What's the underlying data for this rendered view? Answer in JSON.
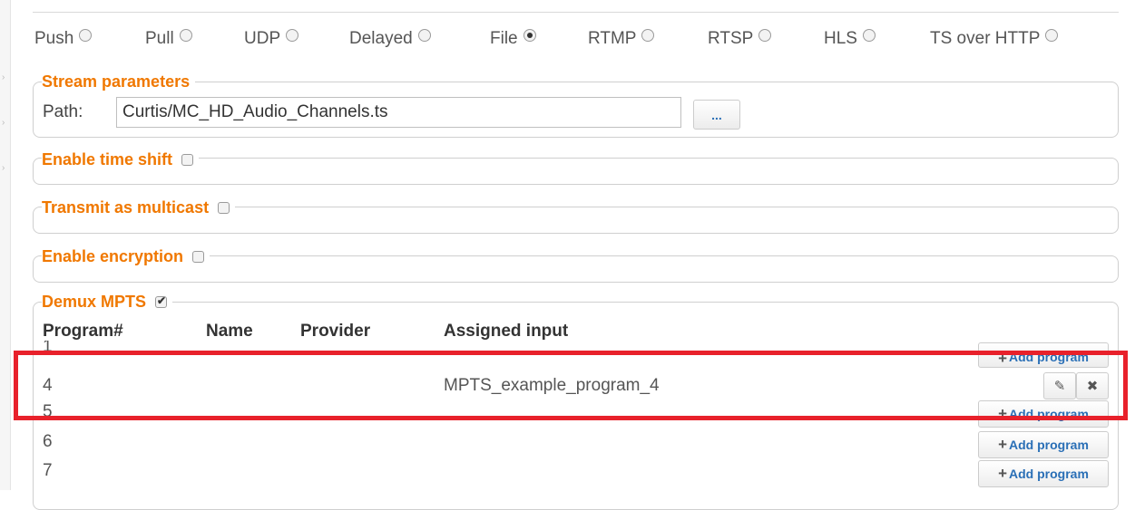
{
  "modes": [
    {
      "label": "Push",
      "checked": false
    },
    {
      "label": "Pull",
      "checked": false
    },
    {
      "label": "UDP",
      "checked": false
    },
    {
      "label": "Delayed",
      "checked": false
    },
    {
      "label": "File",
      "checked": true
    },
    {
      "label": "RTMP",
      "checked": false
    },
    {
      "label": "RTSP",
      "checked": false
    },
    {
      "label": "HLS",
      "checked": false
    },
    {
      "label": "TS over HTTP",
      "checked": false
    }
  ],
  "stream_parameters": {
    "legend": "Stream parameters",
    "path_label": "Path:",
    "path_value": "Curtis/MC_HD_Audio_Channels.ts",
    "browse_label": "..."
  },
  "time_shift": {
    "legend": "Enable time shift",
    "checked": false
  },
  "multicast": {
    "legend": "Transmit as multicast",
    "checked": false
  },
  "encryption": {
    "legend": "Enable encryption",
    "checked": false
  },
  "demux": {
    "legend": "Demux MPTS",
    "checked": true,
    "columns": [
      "Program#",
      "Name",
      "Provider",
      "Assigned input"
    ],
    "rows": [
      {
        "program": "1",
        "name": "",
        "provider": "",
        "input": "",
        "action": "Add program"
      },
      {
        "program": "4",
        "name": "",
        "provider": "",
        "input": "MPTS_example_program_4",
        "action": "edit"
      },
      {
        "program": "5",
        "name": "",
        "provider": "",
        "input": "",
        "action": "Add program"
      },
      {
        "program": "6",
        "name": "",
        "provider": "",
        "input": "",
        "action": "Add program"
      },
      {
        "program": "7",
        "name": "",
        "provider": "",
        "input": "",
        "action": "Add program"
      }
    ]
  },
  "icons": {
    "plus": "+",
    "edit": "✎",
    "remove": "✖"
  },
  "colors": {
    "legend": "#f07800",
    "link": "#2a6fb6",
    "highlight": "#e8212b"
  }
}
